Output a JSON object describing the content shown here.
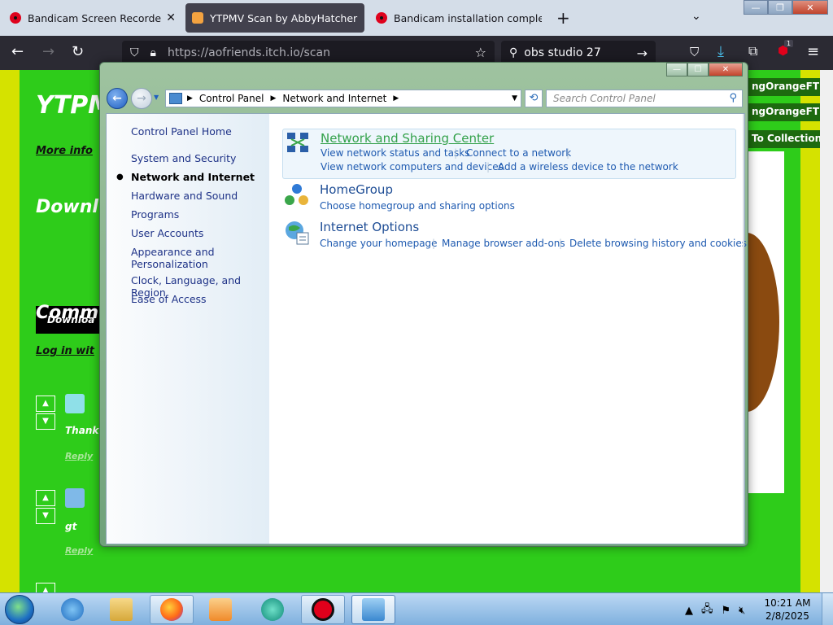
{
  "browser": {
    "tabs": [
      {
        "title": "Bandicam Screen Recorder Dow",
        "active": false
      },
      {
        "title": "YTPMV Scan by AbbyHatcheran",
        "active": true
      },
      {
        "title": "Bandicam installation complete",
        "active": false
      }
    ],
    "new_tab_label": "+",
    "tab_list_label": "⌄",
    "window_buttons": {
      "minimize": "—",
      "maximize": "❐",
      "close": "✕"
    },
    "nav": {
      "back": "←",
      "forward": "→",
      "reload": "↻"
    },
    "url": "https://aofriends.itch.io/scan",
    "search_text": "obs studio 27",
    "extension_badge": "1"
  },
  "webpage": {
    "title_partial": "YTPM",
    "more_info_partial": "More info",
    "download_heading_partial": "Downl",
    "download_button_partial": "Downloa",
    "comments_heading_partial": "Comm",
    "login_partial": "Log in wit",
    "user_tags": [
      "ngOrangeFTL",
      "ngOrangeFTL",
      "To Collection"
    ],
    "comments": [
      {
        "text": "Thank",
        "reply": "Reply"
      },
      {
        "text": "gt",
        "reply": "Reply"
      }
    ]
  },
  "control_panel": {
    "window_buttons": {
      "minimize": "—",
      "maximize": "☐",
      "close": "✕"
    },
    "breadcrumb": [
      "Control Panel",
      "Network and Internet"
    ],
    "search_placeholder": "Search Control Panel",
    "sidebar": {
      "home": "Control Panel Home",
      "items": [
        {
          "label": "System and Security",
          "current": false
        },
        {
          "label": "Network and Internet",
          "current": true
        },
        {
          "label": "Hardware and Sound",
          "current": false
        },
        {
          "label": "Programs",
          "current": false
        },
        {
          "label": "User Accounts",
          "current": false
        },
        {
          "label": "Appearance and Personalization",
          "current": false
        },
        {
          "label": "Clock, Language, and Region",
          "current": false
        },
        {
          "label": "Ease of Access",
          "current": false
        }
      ]
    },
    "categories": [
      {
        "title": "Network and Sharing Center",
        "icon": "network-sharing-icon",
        "tasks": [
          "View network status and tasks",
          "Connect to a network",
          "View network computers and devices",
          "Add a wireless device to the network"
        ]
      },
      {
        "title": "HomeGroup",
        "icon": "homegroup-icon",
        "tasks": [
          "Choose homegroup and sharing options"
        ]
      },
      {
        "title": "Internet Options",
        "icon": "internet-options-icon",
        "tasks": [
          "Change your homepage",
          "Manage browser add-ons",
          "Delete browsing history and cookies"
        ]
      }
    ]
  },
  "taskbar": {
    "clock_time": "10:21 AM",
    "clock_date": "2/8/2025",
    "apps": [
      "internet-explorer-icon",
      "file-explorer-icon",
      "firefox-icon",
      "media-player-icon",
      "chat-bubble-icon",
      "record-icon",
      "control-panel-icon"
    ]
  },
  "colors": {
    "page_green": "#2ecc1a",
    "page_yellow": "#d5e200",
    "link_blue": "#1e5ab0",
    "hover_green": "#33a14a"
  }
}
